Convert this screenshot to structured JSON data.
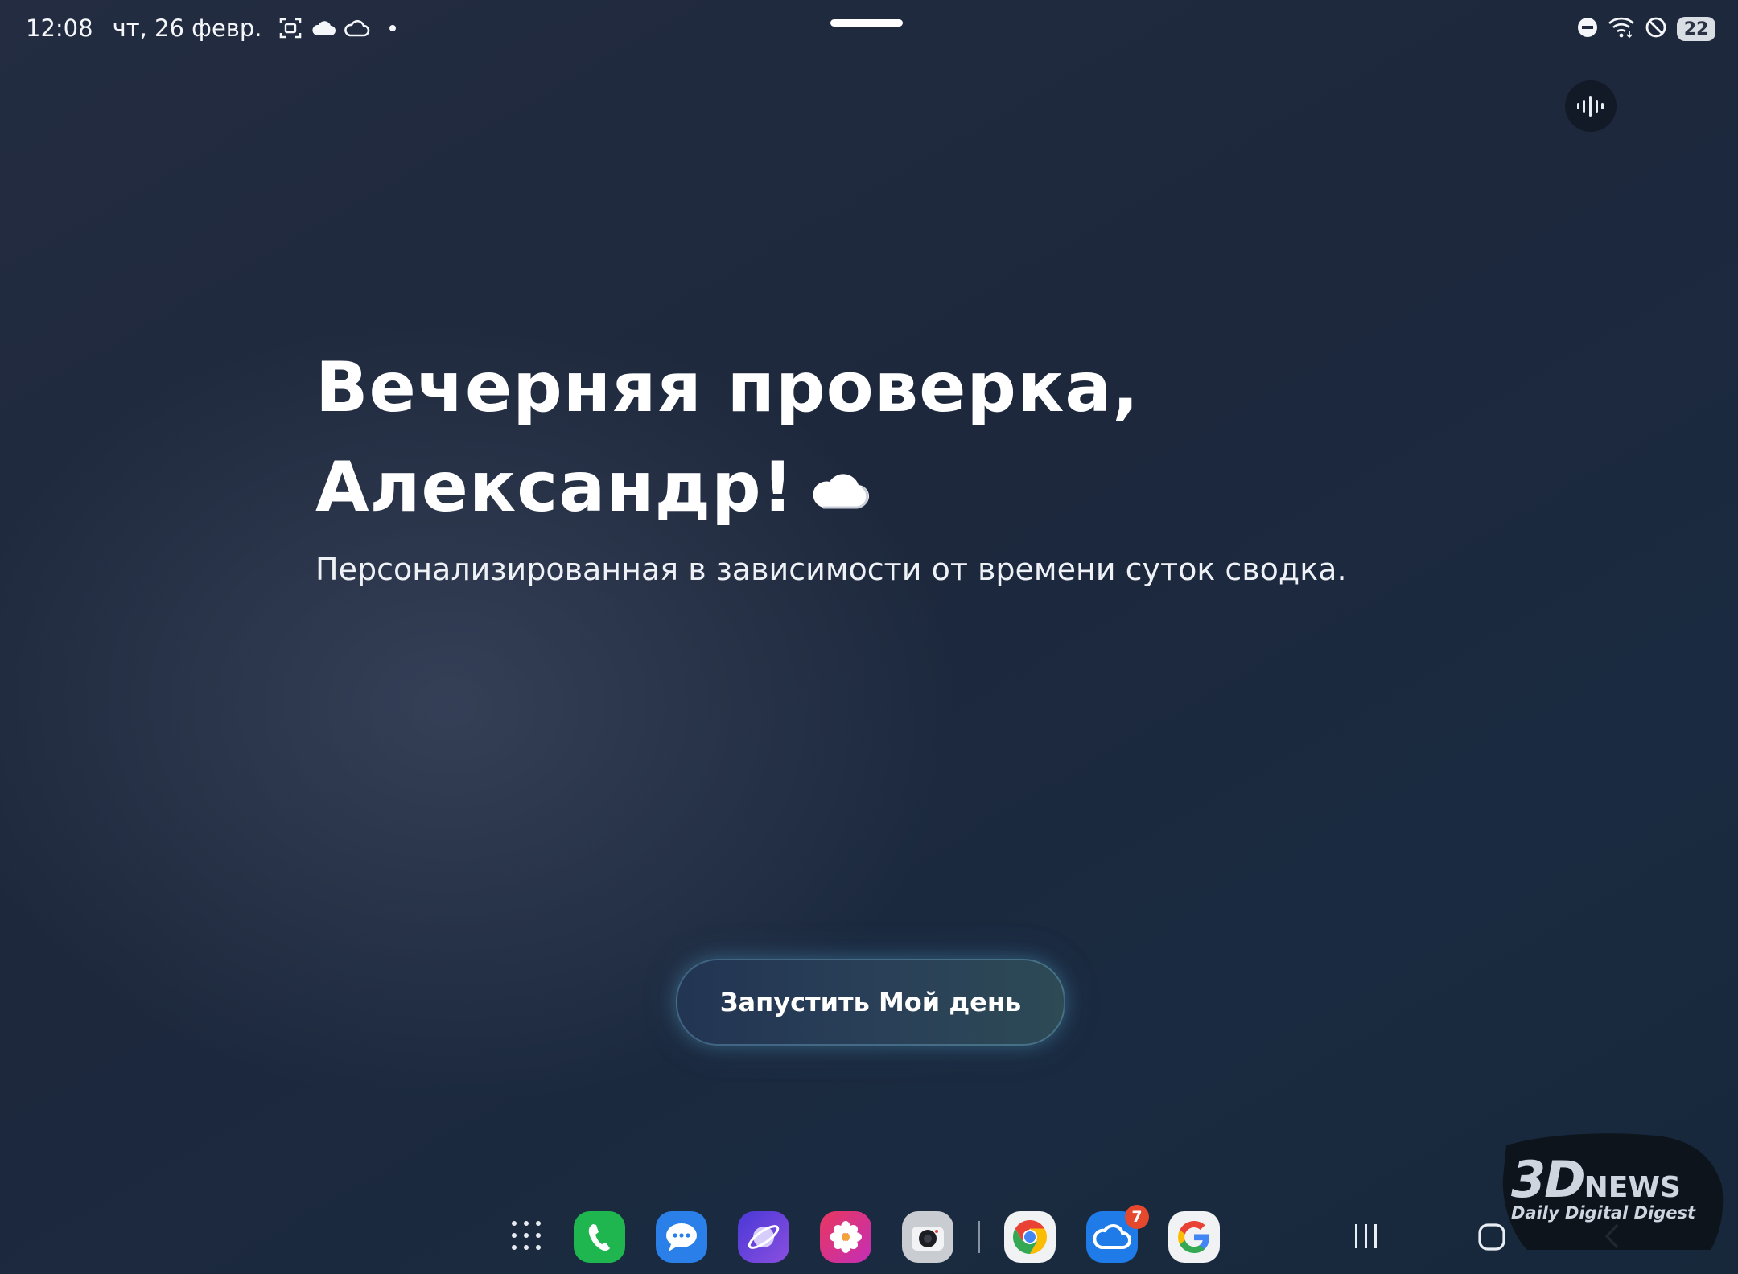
{
  "status_bar": {
    "time": "12:08",
    "date": "чт, 26 февр.",
    "left_icons": [
      "screenshot-icon",
      "cloud-filled-icon",
      "cloud-outline-icon",
      "notification-dot"
    ],
    "right_icons": [
      "do-not-disturb-icon",
      "wifi-icon",
      "no-signal-icon",
      "battery-icon"
    ],
    "battery_level": "22"
  },
  "voice_button": {
    "icon": "voice-wave-icon"
  },
  "greeting": {
    "line1": "Вечерняя проверка,",
    "line2": "Александр!",
    "weather_icon": "cloud-icon"
  },
  "subtitle": "Персонализированная в зависимости от времени суток сводка.",
  "start_button": {
    "label": "Запустить Мой день"
  },
  "dock": {
    "apps": [
      {
        "name": "app-drawer",
        "icon": "apps-grid-icon"
      },
      {
        "name": "phone",
        "icon": "phone-icon",
        "color": "#1fb64f"
      },
      {
        "name": "messages",
        "icon": "chat-bubble-icon",
        "color": "#2a7fe8"
      },
      {
        "name": "internet",
        "icon": "browser-planet-icon",
        "color": "#6a45d8"
      },
      {
        "name": "gallery",
        "icon": "flower-icon",
        "color": "#e5336f"
      },
      {
        "name": "camera",
        "icon": "camera-icon",
        "color": "#c9ccd1"
      },
      {
        "name": "chrome",
        "icon": "chrome-icon"
      },
      {
        "name": "onedrive-cloud",
        "icon": "cloud-app-icon",
        "color": "#1f7be8",
        "badge": "7"
      },
      {
        "name": "google",
        "icon": "google-icon"
      }
    ],
    "nav": [
      "recent-apps-icon",
      "home-icon",
      "back-icon"
    ]
  },
  "watermark": {
    "brand_big": "3D",
    "brand_small": "NEWS",
    "tagline": "Daily Digital Digest"
  }
}
